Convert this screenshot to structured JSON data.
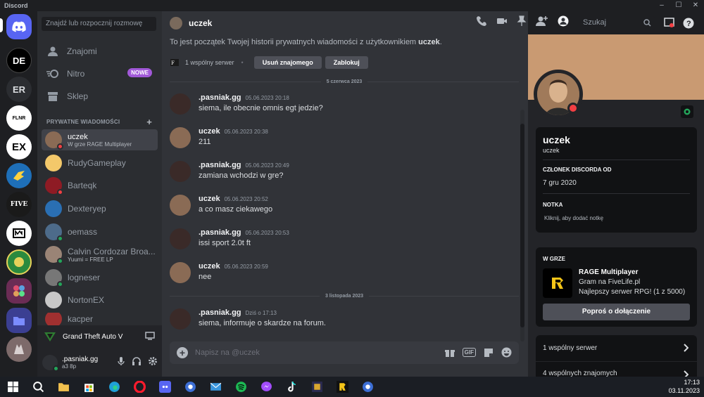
{
  "window": {
    "title": "Discord",
    "controls": [
      "–",
      "☐",
      "✕"
    ]
  },
  "servers": [
    {
      "name": "home",
      "label": "",
      "color": "#5865f2"
    },
    {
      "name": "de",
      "label": "DE",
      "color": "#000000"
    },
    {
      "name": "er",
      "label": "ER",
      "color": "#2b2d31"
    },
    {
      "name": "flnr",
      "label": "FLNR",
      "color": "#ffffff"
    },
    {
      "name": "ex",
      "label": "EX",
      "color": "#ffffff"
    },
    {
      "name": "eagle",
      "label": "",
      "color": "#1e6fb8"
    },
    {
      "name": "five",
      "label": "FIVE",
      "color": "#1a1a1a"
    },
    {
      "name": "box",
      "label": "",
      "color": "#ffffff"
    },
    {
      "name": "stone",
      "label": "",
      "color": "#2b8a3e"
    },
    {
      "name": "multi",
      "label": "",
      "color": "#6b2c55"
    },
    {
      "name": "folder",
      "label": "",
      "color": "#3b3f92"
    },
    {
      "name": "wolf",
      "label": "",
      "color": "#7d6a6a"
    }
  ],
  "sidebar": {
    "search_placeholder": "Znajdź lub rozpocznij rozmowę",
    "nav": [
      {
        "label": "Znajomi",
        "icon": "friends-icon"
      },
      {
        "label": "Nitro",
        "icon": "nitro-icon",
        "badge": "NOWE"
      },
      {
        "label": "Sklep",
        "icon": "shop-icon"
      }
    ],
    "dm_header": "PRYWATNE WIADOMOŚCI",
    "dm_header_plus": "+",
    "dms": [
      {
        "name": "uczek",
        "sub": "W grze RAGE Multiplayer",
        "status": "#f23f43",
        "avatar": "#8a6b55",
        "active": true
      },
      {
        "name": "RudyGameplay",
        "sub": "",
        "status": "",
        "avatar": "#f3c86a"
      },
      {
        "name": "Barteqk",
        "sub": "",
        "status": "#f23f43",
        "avatar": "#8e1b24"
      },
      {
        "name": "Dexteryep",
        "sub": "",
        "status": "",
        "avatar": "#2a6fb3"
      },
      {
        "name": "oemass",
        "sub": "",
        "status": "#23a55a",
        "avatar": "#4d6b8a"
      },
      {
        "name": "Calvin Cordozar Broa...",
        "sub": "Yuumi = FREE LP",
        "status": "#23a55a",
        "avatar": "#9a8476"
      },
      {
        "name": "logneser",
        "sub": "",
        "status": "#23a55a",
        "avatar": "#777777"
      },
      {
        "name": "NortonEX",
        "sub": "",
        "status": "",
        "avatar": "#c8c8c8"
      },
      {
        "name": "kacper",
        "sub": "",
        "status": "",
        "avatar": "#a03030"
      }
    ]
  },
  "activity": {
    "game": "Grand Theft Auto V"
  },
  "user_panel": {
    "name": ".pasniak.gg",
    "status": "a3 8p"
  },
  "chat": {
    "header_name": "uczek",
    "intro_prefix": "To jest początek Twojej historii prywatnych wiadomości z użytkownikiem ",
    "intro_user": "uczek",
    "intro_suffix": ".",
    "mutual": "1 wspólny serwer",
    "remove_friend": "Usuń znajomego",
    "block": "Zablokuj",
    "dividers": [
      "5 czerwca 2023",
      "3 listopada 2023"
    ],
    "messages": [
      {
        "author": ".pasniak.gg",
        "time": "05.06.2023 20:18",
        "text": "siema, ile obecnie omnis egt jedzie?",
        "avatar": "#3a2a28"
      },
      {
        "author": "uczek",
        "time": "05.06.2023 20:38",
        "text": "211",
        "avatar": "#8a6b55"
      },
      {
        "author": ".pasniak.gg",
        "time": "05.06.2023 20:49",
        "text": "zamiana wchodzi w gre?",
        "avatar": "#3a2a28"
      },
      {
        "author": "uczek",
        "time": "05.06.2023 20:52",
        "text": "a co masz ciekawego",
        "avatar": "#8a6b55"
      },
      {
        "author": ".pasniak.gg",
        "time": "05.06.2023 20:53",
        "text": "issi sport 2.0t ft",
        "avatar": "#3a2a28"
      },
      {
        "author": "uczek",
        "time": "05.06.2023 20:59",
        "text": "nee",
        "avatar": "#8a6b55"
      },
      {
        "author": ".pasniak.gg",
        "time": "Dziś o 17:13",
        "text": "siema, informuje o skardze na forum.",
        "avatar": "#3a2a28"
      }
    ],
    "composer_placeholder": "Napisz na @uczek",
    "gif": "GIF"
  },
  "search": {
    "placeholder": "Szukaj"
  },
  "profile": {
    "display_name": "uczek",
    "username": "uczek",
    "member_label": "CZŁONEK DISCORDA OD",
    "member_since": "7 gru 2020",
    "note_label": "NOTKA",
    "note_placeholder": "Kliknij, aby dodać notkę",
    "ingame_label": "W GRZE",
    "game_name": "RAGE Multiplayer",
    "game_line2": "Gram na FiveLife.pl",
    "game_line3": "Najlepszy serwer RPG! (1 z 5000)",
    "join": "Poproś o dołączenie",
    "mutual_servers": "1 wspólny serwer",
    "mutual_friends": "4 wspólnych znajomych"
  },
  "taskbar": {
    "time": "17:13",
    "date": "03.11.2023"
  },
  "colors": {
    "accent": "#5865f2",
    "dnd": "#f23f43",
    "online": "#23a55a",
    "nitro": "#a259d9"
  }
}
